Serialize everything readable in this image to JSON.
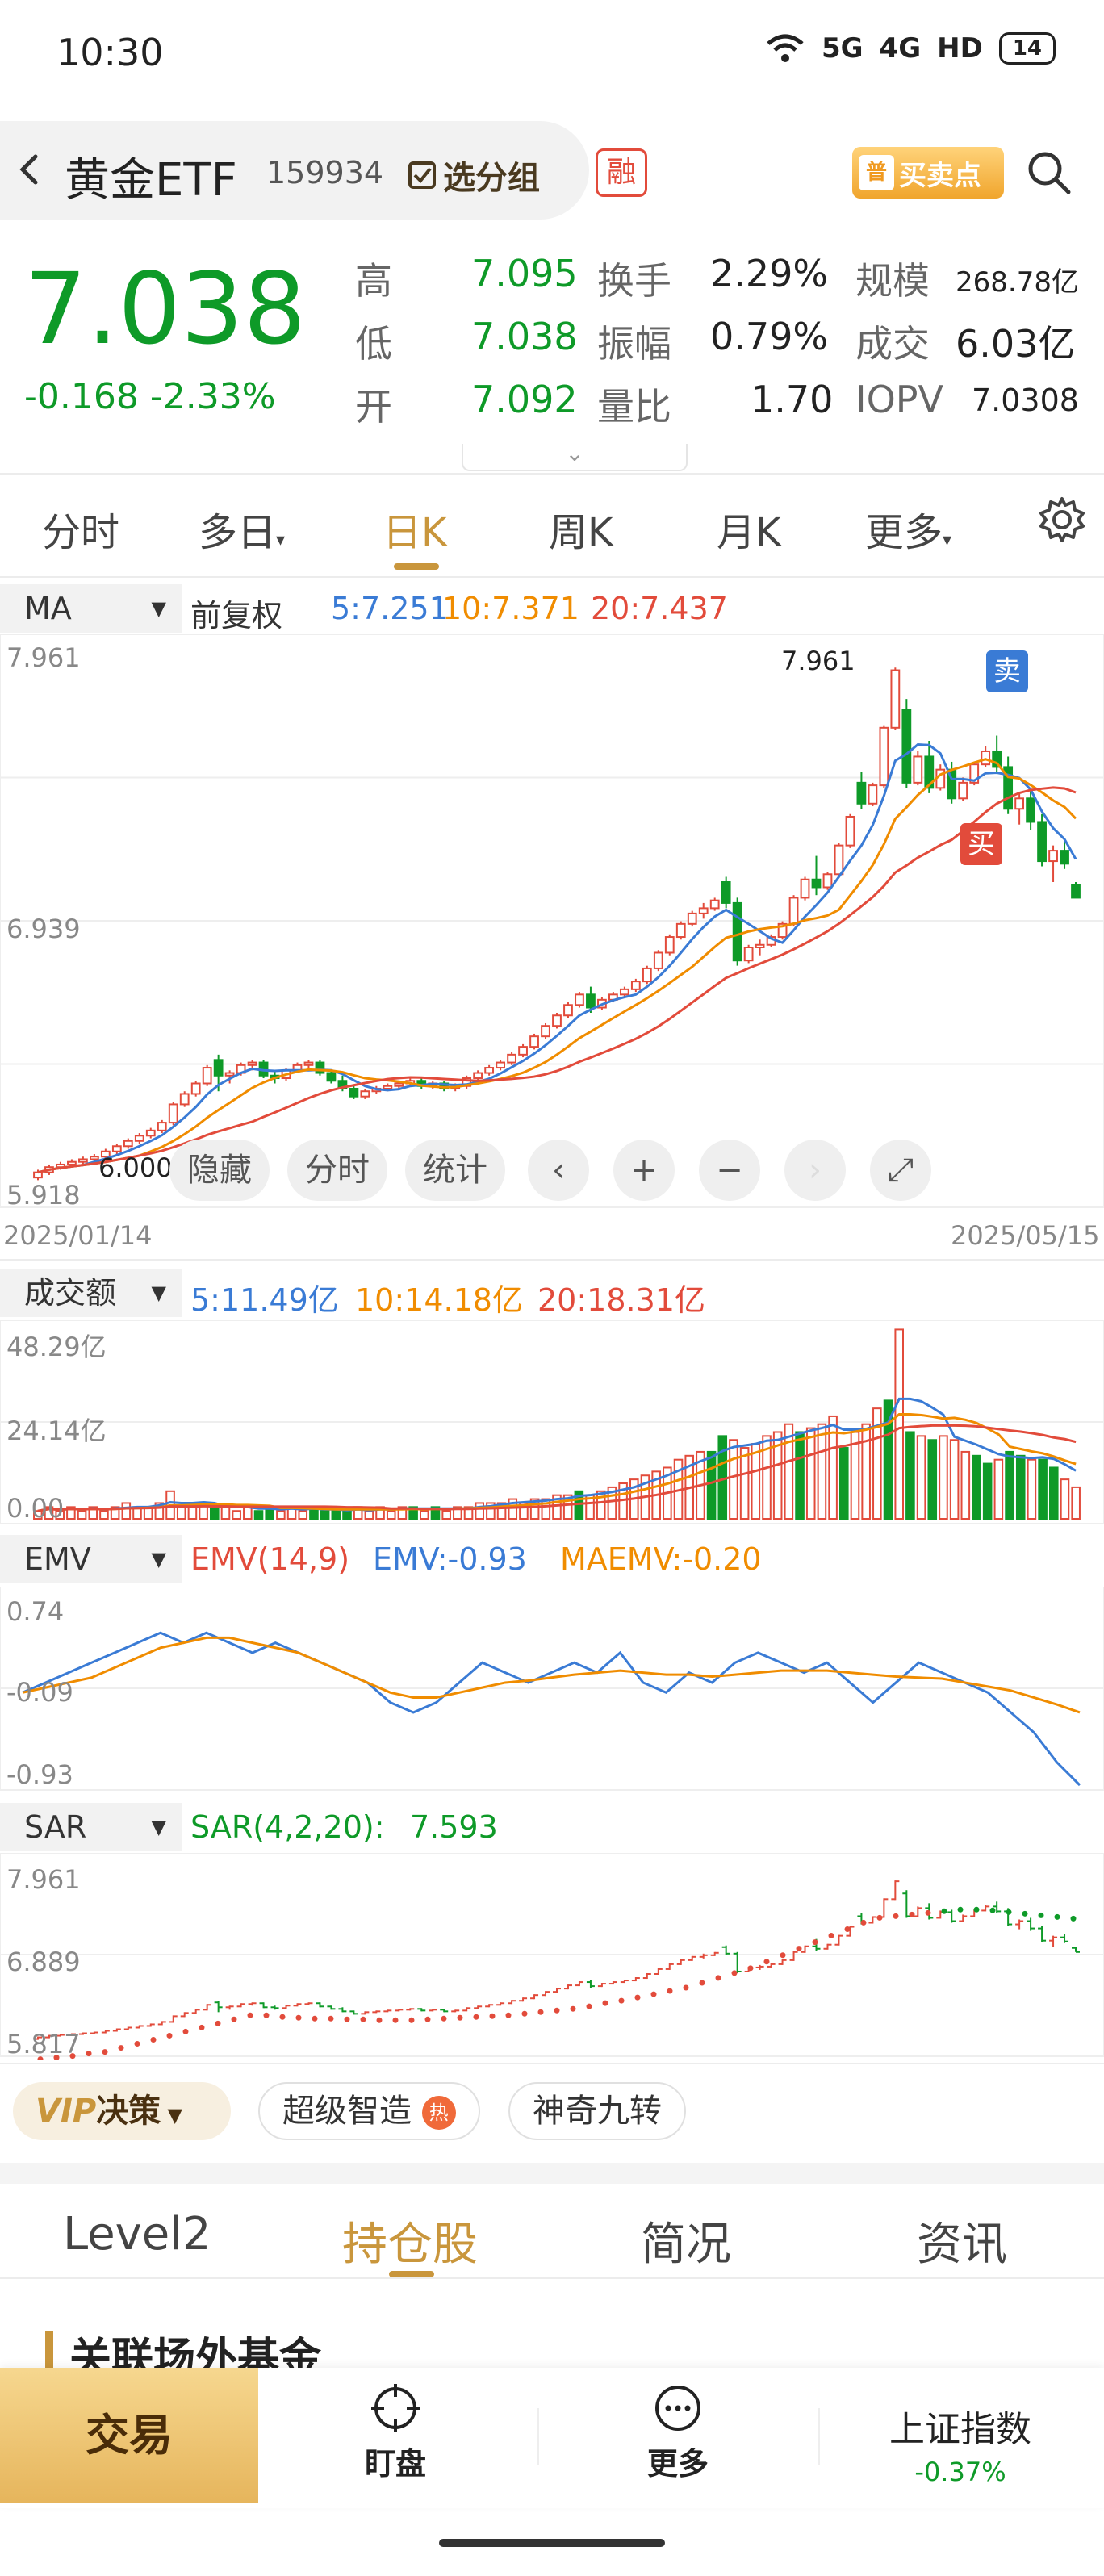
{
  "status_bar": {
    "time": "10:30",
    "signal_1": "5G",
    "signal_2": "4G",
    "hd": "HD",
    "battery": "14"
  },
  "header": {
    "name": "黄金ETF",
    "code": "159934",
    "select_group": "选分组",
    "rong": "融",
    "buy_sell_point": "买卖点",
    "pu": "普"
  },
  "quote": {
    "price": "7.038",
    "change": "-0.168",
    "change_pct": "-2.33%",
    "rows": [
      [
        {
          "l": "高",
          "v": "7.095"
        },
        {
          "l": "换手",
          "v": "2.29%"
        },
        {
          "l": "规模",
          "v": "268.78亿"
        }
      ],
      [
        {
          "l": "低",
          "v": "7.038"
        },
        {
          "l": "振幅",
          "v": "0.79%"
        },
        {
          "l": "成交",
          "v": "6.03亿"
        }
      ],
      [
        {
          "l": "开",
          "v": "7.092"
        },
        {
          "l": "量比",
          "v": "1.70"
        },
        {
          "l": "IOPV",
          "v": "7.0308"
        }
      ]
    ]
  },
  "k_tabs": [
    "分时",
    "多日",
    "日K",
    "周K",
    "月K",
    "更多"
  ],
  "k_tab_active": "日K",
  "main_panel": {
    "indicator": "MA",
    "adjust": "前复权",
    "ma5": "5:7.251",
    "ma10": "10:7.371",
    "ma20": "20:7.437"
  },
  "main_axis": {
    "top": "7.961",
    "mid": "6.939",
    "bottom": "5.918",
    "start_date": "2025/01/14",
    "end_date": "2025/05/15",
    "high_mark": "7.961",
    "low_mark": "6.000"
  },
  "signals": {
    "sell": "卖",
    "buy": "买"
  },
  "controls": {
    "hide": "隐藏",
    "timeshare": "分时",
    "stats": "统计"
  },
  "vol_panel": {
    "indicator": "成交额",
    "ma5": "5:11.49亿",
    "ma10": "10:14.18亿",
    "ma20": "20:18.31亿",
    "top": "48.29亿",
    "mid": "24.14亿",
    "bottom": "0.00"
  },
  "emv_panel": {
    "indicator": "EMV",
    "param": "EMV(14,9)",
    "emv": "EMV:-0.93",
    "maemv": "MAEMV:-0.20",
    "top": "0.74",
    "mid": "-0.09",
    "bottom": "-0.93"
  },
  "sar_panel": {
    "indicator": "SAR",
    "param": "SAR(4,2,20):",
    "value": "7.593",
    "top": "7.961",
    "mid": "6.889",
    "bottom": "5.817"
  },
  "strategies": {
    "vip": "VIP",
    "decision": "决策",
    "super": "超级智造",
    "hot": "热",
    "magic": "神奇九转"
  },
  "bottom_tabs": [
    "Level2",
    "持仓股",
    "简况",
    "资讯"
  ],
  "bottom_tab_active": "持仓股",
  "section_title": "关联场外基金",
  "nav": {
    "trade": "交易",
    "watch": "盯盘",
    "more": "更多",
    "index_name": "上证指数",
    "index_change": "-0.37%"
  },
  "colors": {
    "up": "#e24b3b",
    "down": "#0e9a28",
    "ma5": "#3a7bd5",
    "ma10": "#f08c00",
    "ma20": "#e24b3b",
    "accent": "#c9963c"
  },
  "chart_data": [
    {
      "type": "candlestick",
      "title": "",
      "x_range": [
        "2025/01/14",
        "2025/05/15"
      ],
      "ylim": [
        5.918,
        7.961
      ],
      "ohlc": [
        [
          5.97,
          6.0,
          5.96,
          5.99
        ],
        [
          5.99,
          6.02,
          5.98,
          6.01
        ],
        [
          6.01,
          6.03,
          6.0,
          6.02
        ],
        [
          6.02,
          6.04,
          6.01,
          6.03
        ],
        [
          6.03,
          6.05,
          6.02,
          6.04
        ],
        [
          6.04,
          6.06,
          6.03,
          6.05
        ],
        [
          6.05,
          6.08,
          6.04,
          6.07
        ],
        [
          6.07,
          6.1,
          6.06,
          6.09
        ],
        [
          6.09,
          6.12,
          6.08,
          6.11
        ],
        [
          6.11,
          6.14,
          6.1,
          6.13
        ],
        [
          6.13,
          6.16,
          6.12,
          6.15
        ],
        [
          6.15,
          6.19,
          6.14,
          6.18
        ],
        [
          6.18,
          6.26,
          6.17,
          6.25
        ],
        [
          6.25,
          6.3,
          6.24,
          6.29
        ],
        [
          6.29,
          6.34,
          6.28,
          6.33
        ],
        [
          6.33,
          6.4,
          6.32,
          6.39
        ],
        [
          6.42,
          6.44,
          6.3,
          6.36
        ],
        [
          6.36,
          6.38,
          6.33,
          6.37
        ],
        [
          6.37,
          6.41,
          6.36,
          6.4
        ],
        [
          6.4,
          6.42,
          6.38,
          6.41
        ],
        [
          6.41,
          6.42,
          6.35,
          6.36
        ],
        [
          6.36,
          6.38,
          6.33,
          6.35
        ],
        [
          6.35,
          6.39,
          6.34,
          6.38
        ],
        [
          6.38,
          6.41,
          6.37,
          6.4
        ],
        [
          6.4,
          6.42,
          6.39,
          6.41
        ],
        [
          6.41,
          6.42,
          6.36,
          6.37
        ],
        [
          6.37,
          6.38,
          6.33,
          6.34
        ],
        [
          6.34,
          6.36,
          6.3,
          6.31
        ],
        [
          6.31,
          6.32,
          6.27,
          6.28
        ],
        [
          6.28,
          6.31,
          6.27,
          6.3
        ],
        [
          6.3,
          6.32,
          6.29,
          6.31
        ],
        [
          6.31,
          6.33,
          6.3,
          6.32
        ],
        [
          6.32,
          6.34,
          6.31,
          6.33
        ],
        [
          6.33,
          6.35,
          6.32,
          6.34
        ],
        [
          6.34,
          6.35,
          6.31,
          6.32
        ],
        [
          6.32,
          6.34,
          6.31,
          6.33
        ],
        [
          6.33,
          6.34,
          6.3,
          6.31
        ],
        [
          6.31,
          6.33,
          6.3,
          6.32
        ],
        [
          6.32,
          6.36,
          6.31,
          6.35
        ],
        [
          6.35,
          6.38,
          6.34,
          6.37
        ],
        [
          6.37,
          6.4,
          6.36,
          6.39
        ],
        [
          6.39,
          6.42,
          6.38,
          6.41
        ],
        [
          6.41,
          6.45,
          6.4,
          6.44
        ],
        [
          6.44,
          6.48,
          6.43,
          6.47
        ],
        [
          6.47,
          6.52,
          6.46,
          6.51
        ],
        [
          6.51,
          6.56,
          6.5,
          6.55
        ],
        [
          6.55,
          6.6,
          6.54,
          6.59
        ],
        [
          6.59,
          6.64,
          6.58,
          6.63
        ],
        [
          6.63,
          6.68,
          6.62,
          6.67
        ],
        [
          6.67,
          6.7,
          6.6,
          6.62
        ],
        [
          6.62,
          6.66,
          6.61,
          6.65
        ],
        [
          6.65,
          6.68,
          6.64,
          6.67
        ],
        [
          6.67,
          6.7,
          6.66,
          6.69
        ],
        [
          6.69,
          6.73,
          6.68,
          6.72
        ],
        [
          6.72,
          6.78,
          6.71,
          6.77
        ],
        [
          6.77,
          6.84,
          6.76,
          6.83
        ],
        [
          6.83,
          6.9,
          6.82,
          6.89
        ],
        [
          6.89,
          6.95,
          6.88,
          6.94
        ],
        [
          6.94,
          6.99,
          6.93,
          6.98
        ],
        [
          6.98,
          7.02,
          6.96,
          7.0
        ],
        [
          7.0,
          7.04,
          6.99,
          7.03
        ],
        [
          7.1,
          7.12,
          7.0,
          7.02
        ],
        [
          7.02,
          7.04,
          6.78,
          6.8
        ],
        [
          6.8,
          6.86,
          6.79,
          6.85
        ],
        [
          6.85,
          6.88,
          6.82,
          6.86
        ],
        [
          6.86,
          6.9,
          6.85,
          6.89
        ],
        [
          6.89,
          6.95,
          6.88,
          6.94
        ],
        [
          6.94,
          7.05,
          6.93,
          7.04
        ],
        [
          7.04,
          7.12,
          7.03,
          7.11
        ],
        [
          7.11,
          7.2,
          7.05,
          7.08
        ],
        [
          7.08,
          7.14,
          7.07,
          7.13
        ],
        [
          7.13,
          7.25,
          7.12,
          7.24
        ],
        [
          7.24,
          7.36,
          7.23,
          7.35
        ],
        [
          7.48,
          7.52,
          7.38,
          7.4
        ],
        [
          7.4,
          7.48,
          7.39,
          7.47
        ],
        [
          7.47,
          7.7,
          7.46,
          7.69
        ],
        [
          7.69,
          7.92,
          7.68,
          7.91
        ],
        [
          7.76,
          7.8,
          7.46,
          7.48
        ],
        [
          7.48,
          7.6,
          7.47,
          7.58
        ],
        [
          7.58,
          7.64,
          7.44,
          7.46
        ],
        [
          7.46,
          7.55,
          7.45,
          7.53
        ],
        [
          7.53,
          7.56,
          7.4,
          7.42
        ],
        [
          7.42,
          7.5,
          7.41,
          7.48
        ],
        [
          7.48,
          7.56,
          7.47,
          7.55
        ],
        [
          7.55,
          7.62,
          7.54,
          7.6
        ],
        [
          7.6,
          7.66,
          7.52,
          7.54
        ],
        [
          7.54,
          7.58,
          7.36,
          7.38
        ],
        [
          7.38,
          7.44,
          7.32,
          7.42
        ],
        [
          7.42,
          7.46,
          7.3,
          7.33
        ],
        [
          7.33,
          7.36,
          7.16,
          7.18
        ],
        [
          7.18,
          7.24,
          7.1,
          7.22
        ],
        [
          7.22,
          7.26,
          7.15,
          7.17
        ],
        [
          7.09,
          7.1,
          7.04,
          7.04
        ]
      ]
    },
    {
      "type": "bar",
      "title": "成交额",
      "ylim": [
        0,
        48.29
      ],
      "values": [
        2,
        3,
        2,
        3,
        2,
        3,
        2,
        3,
        4,
        3,
        3,
        4,
        7,
        3,
        3,
        4,
        3,
        3,
        2,
        3,
        2,
        3,
        2,
        3,
        2,
        3,
        2,
        2,
        2,
        3,
        2,
        3,
        2,
        3,
        3,
        2,
        3,
        2,
        3,
        3,
        4,
        4,
        4,
        5,
        4,
        5,
        5,
        6,
        6,
        7,
        6,
        7,
        8,
        9,
        10,
        11,
        12,
        13,
        15,
        16,
        17,
        17,
        21,
        20,
        18,
        19,
        21,
        22,
        24,
        22,
        23,
        24,
        26,
        18,
        22,
        24,
        28,
        30,
        48,
        22,
        21,
        20,
        21,
        20,
        17,
        16,
        14,
        15,
        17,
        16,
        15,
        15,
        13,
        10,
        8
      ]
    },
    {
      "type": "line",
      "title": "EMV",
      "ylim": [
        -0.93,
        0.74
      ],
      "series": [
        {
          "name": "EMV",
          "values": [
            0.0,
            0.1,
            0.2,
            0.3,
            0.4,
            0.5,
            0.6,
            0.5,
            0.6,
            0.5,
            0.4,
            0.5,
            0.4,
            0.3,
            0.2,
            0.1,
            -0.1,
            -0.2,
            -0.1,
            0.1,
            0.3,
            0.2,
            0.1,
            0.2,
            0.3,
            0.2,
            0.4,
            0.1,
            0.0,
            0.2,
            0.1,
            0.3,
            0.4,
            0.3,
            0.2,
            0.3,
            0.1,
            -0.1,
            0.1,
            0.3,
            0.2,
            0.1,
            0.0,
            -0.2,
            -0.4,
            -0.7,
            -0.93
          ]
        },
        {
          "name": "MAEMV",
          "values": [
            0.0,
            0.05,
            0.1,
            0.15,
            0.25,
            0.35,
            0.45,
            0.5,
            0.55,
            0.55,
            0.5,
            0.45,
            0.4,
            0.3,
            0.2,
            0.1,
            0.0,
            -0.05,
            -0.05,
            0.0,
            0.05,
            0.1,
            0.12,
            0.15,
            0.18,
            0.2,
            0.22,
            0.2,
            0.18,
            0.18,
            0.16,
            0.18,
            0.2,
            0.22,
            0.22,
            0.22,
            0.2,
            0.18,
            0.16,
            0.15,
            0.14,
            0.1,
            0.06,
            0.02,
            -0.05,
            -0.12,
            -0.2
          ]
        }
      ]
    },
    {
      "type": "scatter",
      "title": "SAR",
      "ylim": [
        5.817,
        7.961
      ],
      "values": [
        5.86,
        5.88,
        5.9,
        5.93,
        5.95,
        6.0,
        6.05,
        6.1,
        6.15,
        6.2,
        6.25,
        6.3,
        6.35,
        6.4,
        6.4,
        6.38,
        6.37,
        6.36,
        6.36,
        6.35,
        6.35,
        6.34,
        6.34,
        6.34,
        6.35,
        6.36,
        6.37,
        6.38,
        6.39,
        6.4,
        6.42,
        6.44,
        6.46,
        6.48,
        6.51,
        6.55,
        6.58,
        6.62,
        6.66,
        6.7,
        6.74,
        6.8,
        6.86,
        6.92,
        6.98,
        7.06,
        7.14,
        7.22,
        7.3,
        7.38,
        7.46,
        7.54,
        7.6,
        7.62,
        7.64,
        7.66,
        7.68,
        7.7,
        7.7,
        7.69,
        7.67,
        7.65,
        7.63,
        7.61,
        7.59
      ]
    }
  ]
}
